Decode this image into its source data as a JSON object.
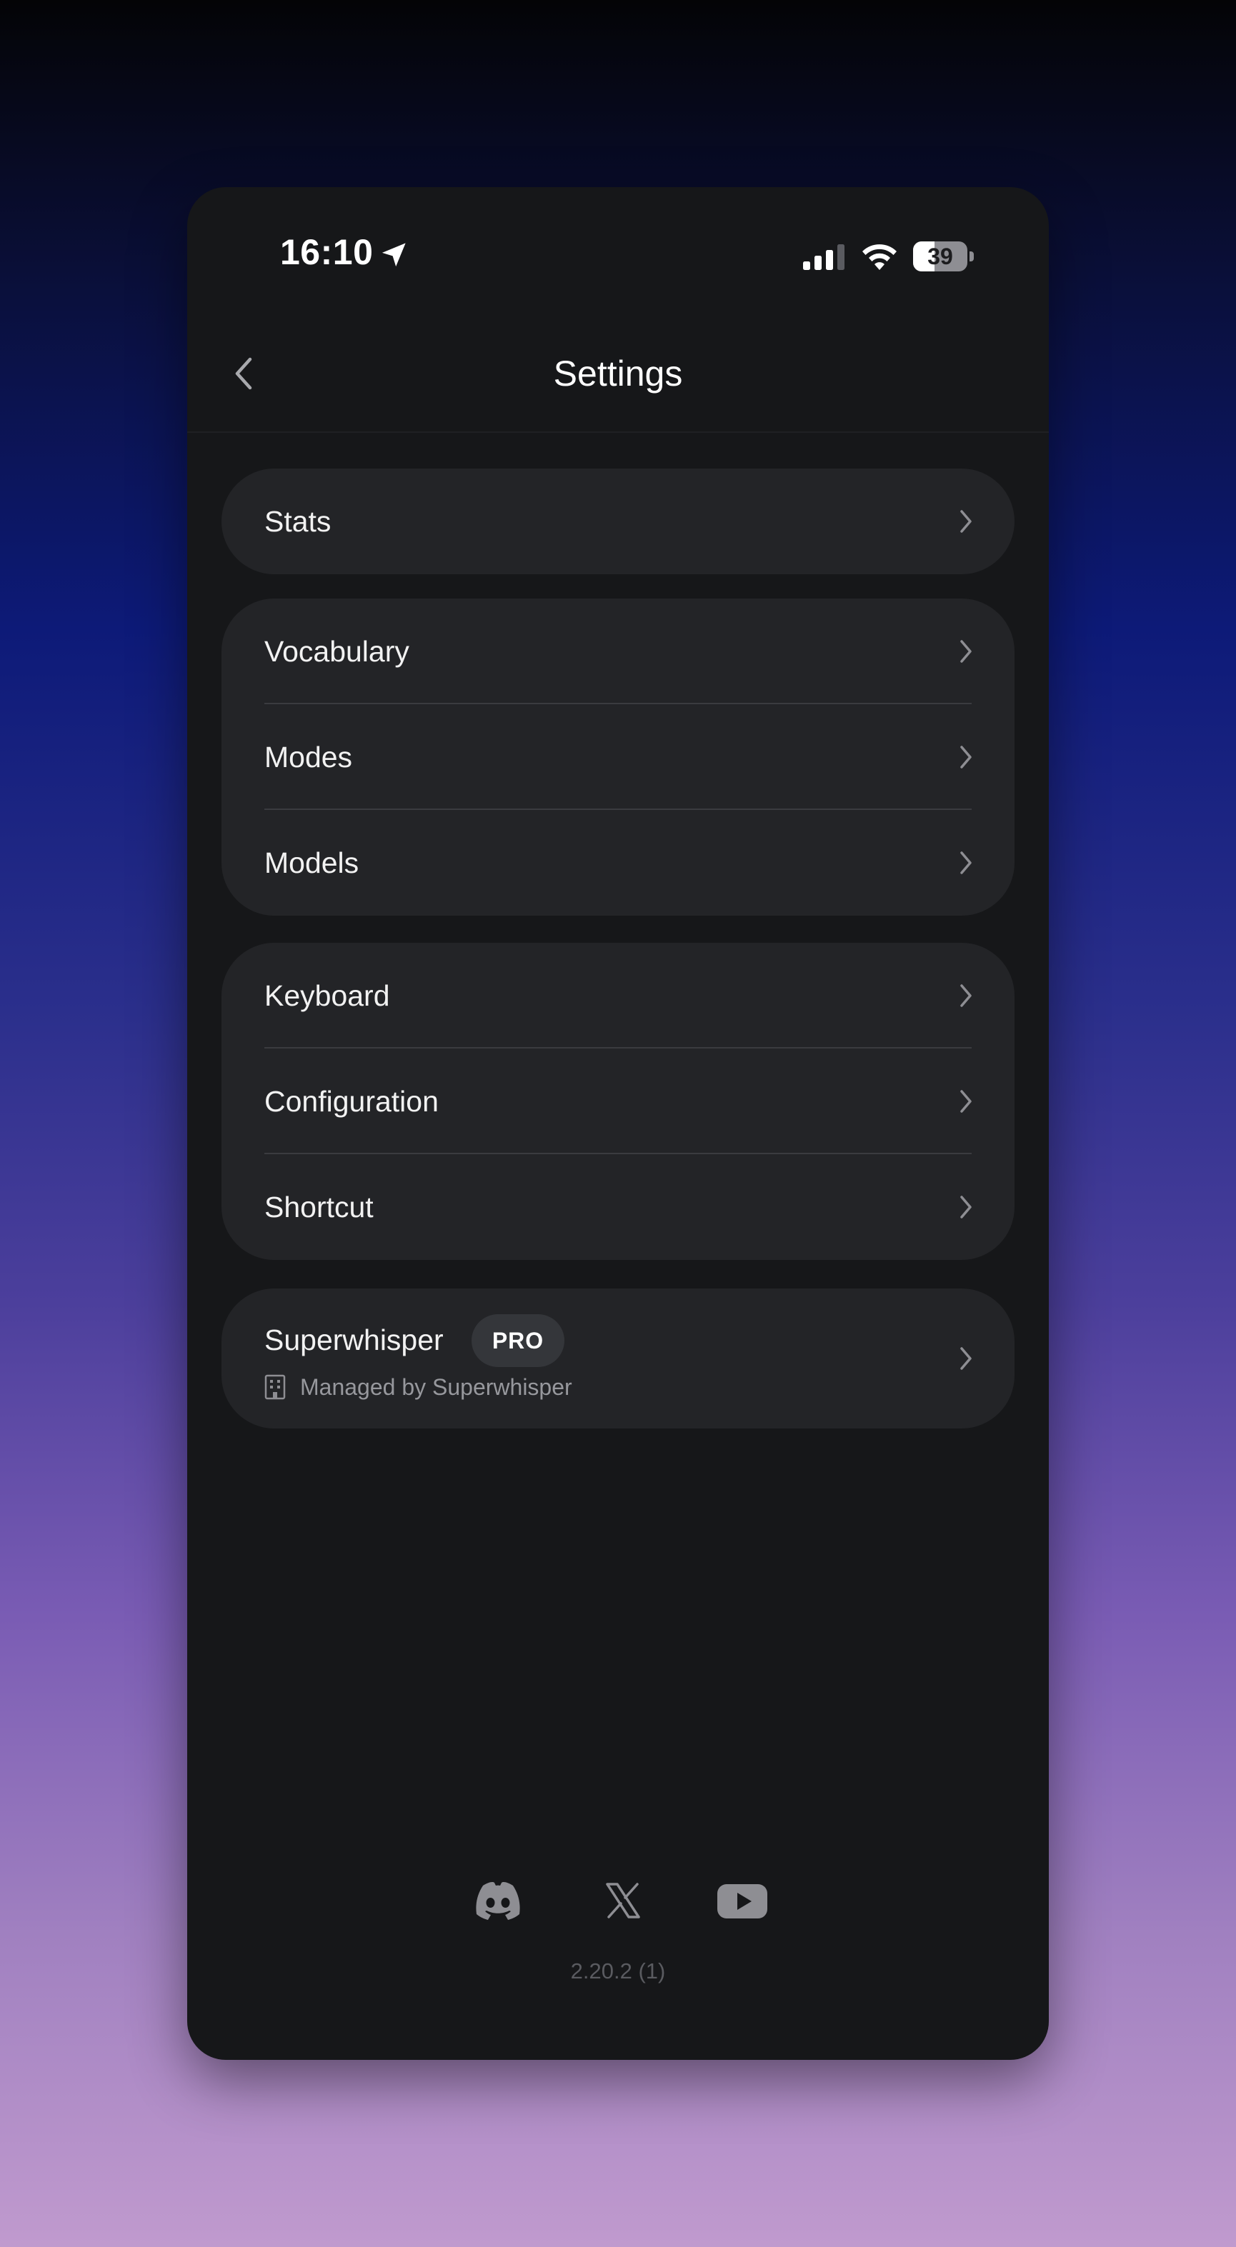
{
  "status_bar": {
    "time": "16:10",
    "battery_level": "39",
    "battery_fraction": 0.39
  },
  "nav": {
    "title": "Settings",
    "back_icon": "chevron-left-icon"
  },
  "groups": [
    {
      "items": [
        {
          "label": "Stats"
        }
      ]
    },
    {
      "items": [
        {
          "label": "Vocabulary"
        },
        {
          "label": "Modes"
        },
        {
          "label": "Models"
        }
      ]
    },
    {
      "items": [
        {
          "label": "Keyboard"
        },
        {
          "label": "Configuration"
        },
        {
          "label": "Shortcut"
        }
      ]
    }
  ],
  "account": {
    "title": "Superwhisper",
    "badge": "PRO",
    "managed_text": "Managed by Superwhisper",
    "managed_icon": "building-icon"
  },
  "footer": {
    "social_icons": [
      "discord-icon",
      "x-icon",
      "youtube-icon"
    ],
    "version": "2.20.2 (1)"
  },
  "colors": {
    "screen_bg": "#161719",
    "card_bg": "#232427",
    "text_primary": "#f2f2f2",
    "text_secondary": "#97989d",
    "icon_gray": "#8e8e93"
  }
}
